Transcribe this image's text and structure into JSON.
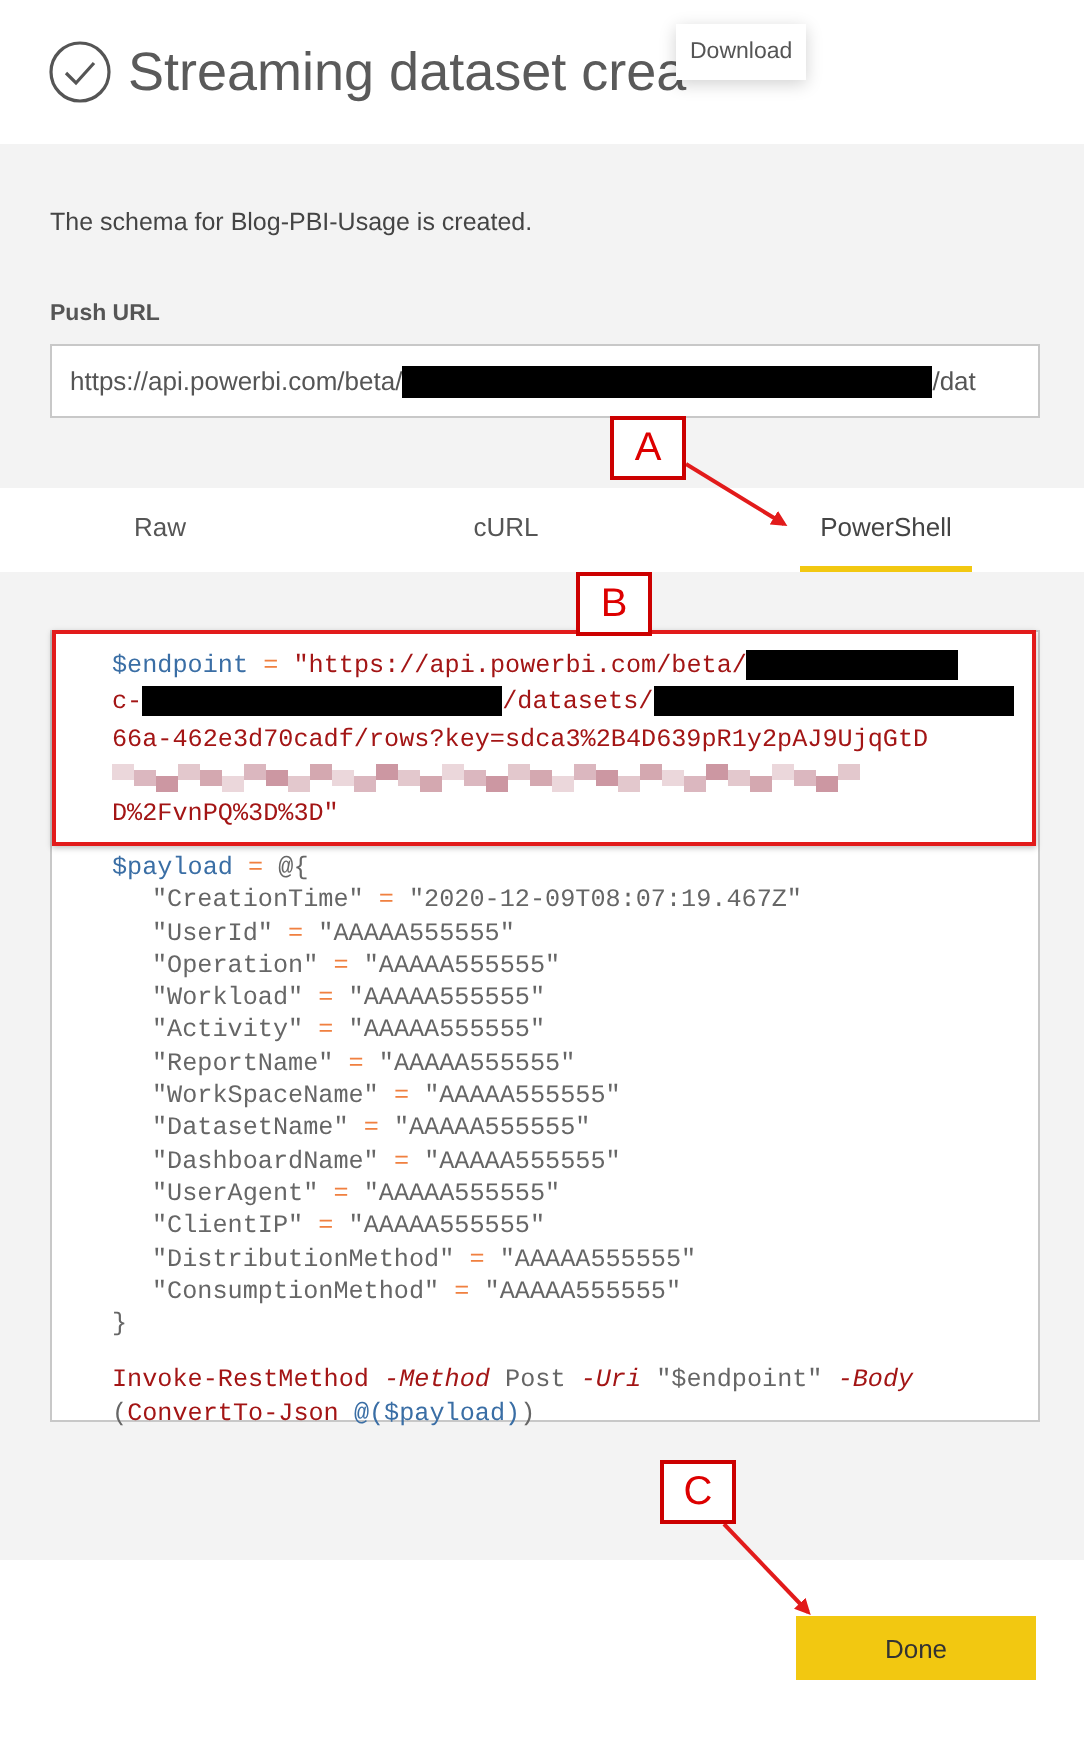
{
  "title": "Streaming dataset crea",
  "tooltip": "Download",
  "description": "The schema for Blog-PBI-Usage is created.",
  "push_url": {
    "label": "Push URL",
    "parts": [
      {
        "kind": "text",
        "text": "https://api.powerbi.com/beta/"
      },
      {
        "kind": "redact_l"
      },
      {
        "kind": "text",
        "text": "/dat"
      }
    ]
  },
  "tabs": [
    {
      "label": "Raw",
      "selected": false
    },
    {
      "label": "cURL",
      "selected": false
    },
    {
      "label": "PowerShell",
      "selected": true
    }
  ],
  "endpoint_code": [
    {
      "tokens": [
        {
          "kind": "var",
          "text": "$endpoint"
        },
        {
          "kind": "op",
          "text": "="
        },
        {
          "kind": "str",
          "text": "\"https://api.powerbi.com/beta/"
        },
        {
          "kind": "redact_s",
          "join": true
        }
      ]
    },
    {
      "tokens": [
        {
          "kind": "str",
          "text": "c-"
        },
        {
          "kind": "redact_m",
          "join": true
        },
        {
          "kind": "str",
          "text": "/datasets/",
          "join": true
        },
        {
          "kind": "redact_m",
          "join": true
        }
      ]
    },
    {
      "tokens": [
        {
          "kind": "str",
          "text": "66a-462e3d70cadf/rows?key=sdca3%2B4D639pR1y2pAJ9UjqGtD"
        }
      ]
    },
    {
      "tokens": [
        {
          "kind": "blur"
        }
      ]
    },
    {
      "tokens": [
        {
          "kind": "str",
          "text": "D%2FvnPQ%3D%3D\""
        }
      ]
    }
  ],
  "code": [
    {
      "tokens": [
        {
          "kind": "var",
          "text": "$payload"
        },
        {
          "kind": "op",
          "text": "="
        },
        {
          "kind": "plain",
          "text": "@{"
        }
      ]
    },
    {
      "indent": true,
      "tokens": [
        {
          "kind": "plain",
          "text": "\"CreationTime\""
        },
        {
          "kind": "op",
          "text": "="
        },
        {
          "kind": "plain",
          "text": "\"2020-12-09T08:07:19.467Z\""
        }
      ]
    },
    {
      "indent": true,
      "tokens": [
        {
          "kind": "plain",
          "text": "\"UserId\""
        },
        {
          "kind": "op",
          "text": "="
        },
        {
          "kind": "plain",
          "text": "\"AAAAA555555\""
        }
      ]
    },
    {
      "indent": true,
      "tokens": [
        {
          "kind": "plain",
          "text": "\"Operation\""
        },
        {
          "kind": "op",
          "text": "="
        },
        {
          "kind": "plain",
          "text": "\"AAAAA555555\""
        }
      ]
    },
    {
      "indent": true,
      "tokens": [
        {
          "kind": "plain",
          "text": "\"Workload\""
        },
        {
          "kind": "op",
          "text": "="
        },
        {
          "kind": "plain",
          "text": "\"AAAAA555555\""
        }
      ]
    },
    {
      "indent": true,
      "tokens": [
        {
          "kind": "plain",
          "text": "\"Activity\""
        },
        {
          "kind": "op",
          "text": "="
        },
        {
          "kind": "plain",
          "text": "\"AAAAA555555\""
        }
      ]
    },
    {
      "indent": true,
      "tokens": [
        {
          "kind": "plain",
          "text": "\"ReportName\""
        },
        {
          "kind": "op",
          "text": "="
        },
        {
          "kind": "plain",
          "text": "\"AAAAA555555\""
        }
      ]
    },
    {
      "indent": true,
      "tokens": [
        {
          "kind": "plain",
          "text": "\"WorkSpaceName\""
        },
        {
          "kind": "op",
          "text": "="
        },
        {
          "kind": "plain",
          "text": "\"AAAAA555555\""
        }
      ]
    },
    {
      "indent": true,
      "tokens": [
        {
          "kind": "plain",
          "text": "\"DatasetName\""
        },
        {
          "kind": "op",
          "text": "="
        },
        {
          "kind": "plain",
          "text": "\"AAAAA555555\""
        }
      ]
    },
    {
      "indent": true,
      "tokens": [
        {
          "kind": "plain",
          "text": "\"DashboardName\""
        },
        {
          "kind": "op",
          "text": "="
        },
        {
          "kind": "plain",
          "text": "\"AAAAA555555\""
        }
      ]
    },
    {
      "indent": true,
      "tokens": [
        {
          "kind": "plain",
          "text": "\"UserAgent\""
        },
        {
          "kind": "op",
          "text": "="
        },
        {
          "kind": "plain",
          "text": "\"AAAAA555555\""
        }
      ]
    },
    {
      "indent": true,
      "tokens": [
        {
          "kind": "plain",
          "text": "\"ClientIP\""
        },
        {
          "kind": "op",
          "text": "="
        },
        {
          "kind": "plain",
          "text": "\"AAAAA555555\""
        }
      ]
    },
    {
      "indent": true,
      "tokens": [
        {
          "kind": "plain",
          "text": "\"DistributionMethod\""
        },
        {
          "kind": "op",
          "text": "="
        },
        {
          "kind": "plain",
          "text": "\"AAAAA555555\""
        }
      ]
    },
    {
      "indent": true,
      "tokens": [
        {
          "kind": "plain",
          "text": "\"ConsumptionMethod\""
        },
        {
          "kind": "op",
          "text": "="
        },
        {
          "kind": "plain",
          "text": "\"AAAAA555555\""
        }
      ]
    },
    {
      "tokens": [
        {
          "kind": "plain",
          "text": "}"
        }
      ]
    },
    {
      "spaced": true,
      "tokens": [
        {
          "kind": "cmd",
          "text": "Invoke-RestMethod"
        },
        {
          "kind": "param",
          "text": "-Method"
        },
        {
          "kind": "plain",
          "text": "Post"
        },
        {
          "kind": "param",
          "text": "-Uri"
        },
        {
          "kind": "plain",
          "text": "\"$endpoint\""
        },
        {
          "kind": "param",
          "text": "-Body"
        }
      ]
    },
    {
      "tokens": [
        {
          "kind": "plain",
          "text": "("
        },
        {
          "kind": "cmd",
          "text": "ConvertTo-Json",
          "join": true
        },
        {
          "kind": "var",
          "text": "@($payload)"
        },
        {
          "kind": "plain",
          "text": ")",
          "join": true
        }
      ]
    }
  ],
  "done_button": "Done",
  "callouts": [
    {
      "label": "A"
    },
    {
      "label": "B"
    },
    {
      "label": "C"
    }
  ]
}
